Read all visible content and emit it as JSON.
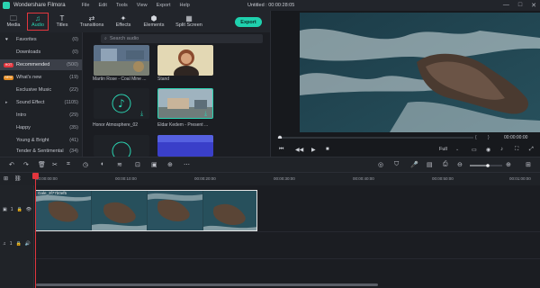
{
  "titlebar": {
    "app_name": "Wondershare Filmora",
    "menu": [
      "File",
      "Edit",
      "Tools",
      "View",
      "Export",
      "Help"
    ],
    "document": "Untitled : 00:00:28:05",
    "win_min": "—",
    "win_max": "□",
    "win_close": "✕"
  },
  "tabs": [
    {
      "label": "Media",
      "icon": "folder-icon",
      "glyph": "🗀"
    },
    {
      "label": "Audio",
      "icon": "music-note-icon",
      "glyph": "♫"
    },
    {
      "label": "Titles",
      "icon": "text-icon",
      "glyph": "T"
    },
    {
      "label": "Transitions",
      "icon": "transition-icon",
      "glyph": "⇄"
    },
    {
      "label": "Effects",
      "icon": "effects-icon",
      "glyph": "✦"
    },
    {
      "label": "Elements",
      "icon": "elements-icon",
      "glyph": "⬢"
    },
    {
      "label": "Split Screen",
      "icon": "split-screen-icon",
      "glyph": "▦"
    }
  ],
  "export_label": "Export",
  "categories": [
    {
      "label": "Favorites",
      "count": "(0)",
      "prefix": "heart-icon",
      "glyph": "♥"
    },
    {
      "label": "Downloads",
      "count": "(0)"
    },
    {
      "label": "Recommended",
      "count": "(500)",
      "badge": "HOT",
      "badge_color": "#e2363e"
    },
    {
      "label": "What's new",
      "count": "(19)",
      "badge": "NEW",
      "badge_color": "#e58a1f"
    },
    {
      "label": "Exclusive Music",
      "count": "(22)"
    },
    {
      "label": "Sound Effect",
      "count": "(1105)",
      "expander": "▸"
    },
    {
      "label": "Intro",
      "count": "(29)"
    },
    {
      "label": "Happy",
      "count": "(35)"
    },
    {
      "label": "Young & Bright",
      "count": "(41)"
    },
    {
      "label": "Tender & Sentimental",
      "count": "(34)"
    }
  ],
  "search": {
    "placeholder": "Search audio",
    "icon": "search-icon",
    "glyph": "⌕"
  },
  "media_items": [
    {
      "label": "Martin Rose - Coal Mine ...",
      "kind": "album-art-blue"
    },
    {
      "label": "Stand",
      "kind": "album-art-portrait"
    },
    {
      "label": "Honor Atmosphere_02",
      "kind": "music-placeholder"
    },
    {
      "label": "Eldar Kedem - Present ...",
      "kind": "album-art-landscape"
    },
    {
      "label": "",
      "kind": "music-placeholder"
    },
    {
      "label": "",
      "kind": "album-art-purple"
    }
  ],
  "preview": {
    "current_time": "00:00:00:00",
    "quality": "Full",
    "bracket_in": "{",
    "bracket_out": "}"
  },
  "timeline": {
    "ruler": [
      "00:00:00:00",
      "00:00:10:00",
      "00:00:20:00",
      "00:00:30:00",
      "00:00:40:00",
      "00:00:50:00",
      "00:01:00:00"
    ],
    "clip_name": "Gale_3f77b0ef5",
    "track1_label": "1",
    "track2_label": "1"
  },
  "colors": {
    "accent": "#1fd1ae",
    "playhead": "#e2363e"
  }
}
